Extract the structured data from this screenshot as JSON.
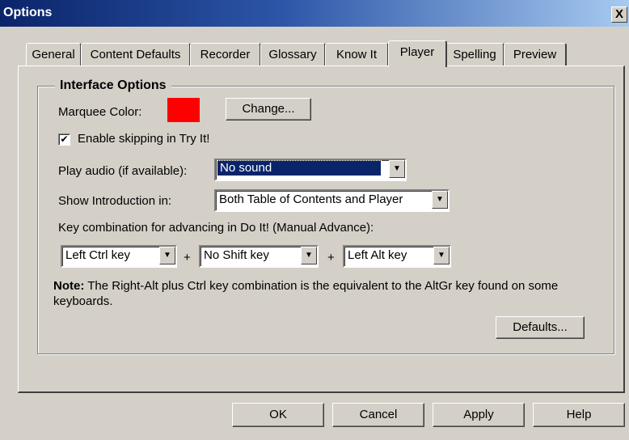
{
  "window": {
    "title": "Options",
    "close_label": "X"
  },
  "tabs": [
    {
      "label": "General"
    },
    {
      "label": "Content Defaults"
    },
    {
      "label": "Recorder"
    },
    {
      "label": "Glossary"
    },
    {
      "label": "Know It"
    },
    {
      "label": "Player"
    },
    {
      "label": "Spelling"
    },
    {
      "label": "Preview"
    }
  ],
  "active_tab": "Player",
  "interface_options": {
    "title": "Interface Options",
    "marquee_label": "Marquee Color:",
    "marquee_color": "#ff0000",
    "change_button": "Change...",
    "enable_skipping_label": "Enable skipping in Try It!",
    "enable_skipping_checked": true,
    "check_mark": "✔",
    "play_audio_label": "Play audio (if available):",
    "play_audio_value": "No sound",
    "show_intro_label": "Show Introduction in:",
    "show_intro_value": "Both Table of Contents and Player",
    "key_combo_label": "Key combination for advancing in Do It! (Manual Advance):",
    "key1_value": "Left Ctrl key",
    "key2_value": "No Shift key",
    "key3_value": "Left Alt key",
    "plus": "+",
    "note_bold": "Note:",
    "note_text": " The Right-Alt plus Ctrl key combination is the equivalent to the AltGr key found on some keyboards.",
    "defaults_button": "Defaults..."
  },
  "footer": {
    "ok": "OK",
    "cancel": "Cancel",
    "apply": "Apply",
    "help": "Help"
  },
  "dropdown_arrow": "▼",
  "colors": {
    "titlebar_start": "#0a246a",
    "titlebar_end": "#a6caf0",
    "face": "#d4d0c8",
    "selection": "#0a246a"
  }
}
